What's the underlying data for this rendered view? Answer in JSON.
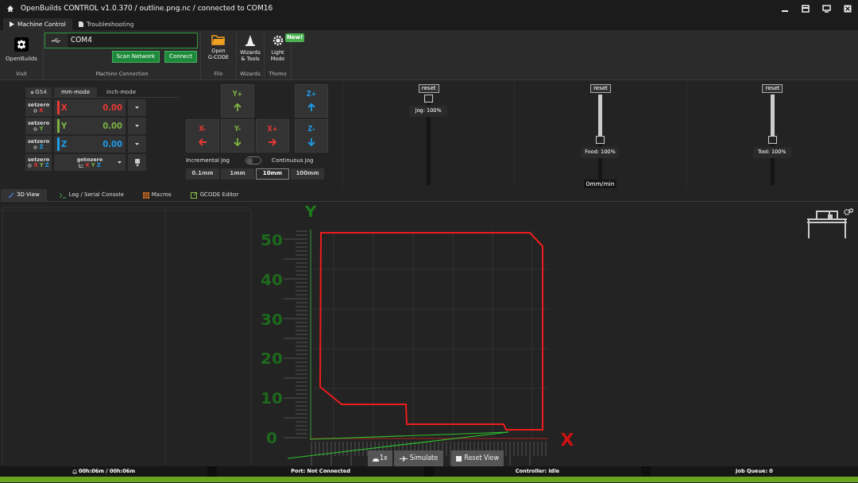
{
  "window": {
    "title": "OpenBuilds CONTROL v1.0.370 / outline.png.nc / connected to COM16"
  },
  "tabs": [
    {
      "label": "Machine Control",
      "selected": true
    },
    {
      "label": "Troubleshooting",
      "selected": false
    }
  ],
  "ribbon": {
    "visit": {
      "button": "OpenBuilds",
      "group": "Visit"
    },
    "connection": {
      "port": "COM4",
      "scan": "Scan Network",
      "connect": "Connect",
      "group": "Machine Connection"
    },
    "file": {
      "button": "Open G-CODE",
      "group": "File"
    },
    "wizards": {
      "button": "Wizards & Tools",
      "group": "Wizards"
    },
    "theme": {
      "button": "Light Mode",
      "badge": "New!",
      "group": "Theme"
    }
  },
  "dro": {
    "wcs": "G54",
    "units": [
      {
        "label": "mm-mode",
        "selected": true
      },
      {
        "label": "inch-mode",
        "selected": false
      }
    ],
    "rows": [
      {
        "setzero": "setzero",
        "setzero_axis": "X",
        "axis": "X",
        "value": "0.00",
        "color": "#e53935"
      },
      {
        "setzero": "setzero",
        "setzero_axis": "Y",
        "axis": "Y",
        "value": "0.00",
        "color": "#7cb342"
      },
      {
        "setzero": "setzero",
        "setzero_axis": "Z",
        "axis": "Z",
        "value": "0.00",
        "color": "#1e9be6"
      }
    ],
    "all": {
      "setzero": "setzero",
      "axes": [
        {
          "label": "X",
          "color": "#e53935"
        },
        {
          "label": "Y",
          "color": "#7cb342"
        },
        {
          "label": "Z",
          "color": "#1e9be6"
        }
      ],
      "gotozero": "gotozero",
      "goto_axes": [
        {
          "label": "X",
          "color": "#e53935"
        },
        {
          "label": "Y",
          "color": "#7cb342"
        },
        {
          "label": "Z",
          "color": "#1e9be6"
        }
      ]
    }
  },
  "jog": {
    "buttons": [
      {
        "label": "Y+",
        "kind": "y_up"
      },
      {
        "label": "Z+",
        "kind": "z_up"
      },
      {
        "label": "X-",
        "kind": "x_left"
      },
      {
        "label": "Y-",
        "kind": "y_down"
      },
      {
        "label": "X+",
        "kind": "x_right"
      },
      {
        "label": "Z-",
        "kind": "z_down"
      }
    ],
    "incremental": "Incremental Jog",
    "continuous": "Continuous Jog",
    "continuous_on": false,
    "steps": [
      {
        "label": "0.1mm",
        "selected": false
      },
      {
        "label": "1mm",
        "selected": false
      },
      {
        "label": "10mm",
        "selected": true
      },
      {
        "label": "100mm",
        "selected": false
      }
    ]
  },
  "overrides": [
    {
      "reset": "reset",
      "label": "Jog: 100%",
      "level": 1.0
    },
    {
      "reset": "reset",
      "label": "Feed: 100%",
      "level": 0.5,
      "reading": "0mm/min"
    },
    {
      "reset": "reset",
      "label": "Tool: 100%",
      "level": 0.5
    }
  ],
  "view_tabs": [
    {
      "label": "3D View",
      "selected": true,
      "kind": "view"
    },
    {
      "label": "Log / Serial Console",
      "selected": false,
      "kind": "console"
    },
    {
      "label": "Macros",
      "selected": false,
      "kind": "macros"
    },
    {
      "label": "GCODE Editor",
      "selected": false,
      "kind": "editor"
    }
  ],
  "viewer": {
    "y_axis": "Y",
    "x_axis": "X",
    "y_labels": [
      "50",
      "40",
      "30",
      "20",
      "10",
      "0"
    ],
    "speed": "1x",
    "simulate": "Simulate",
    "reset_view": "Reset View"
  },
  "status_bar": {
    "time": "00h:06m / 00h:06m",
    "port": "Port: Not Connected",
    "controller": "Controller: Idle",
    "queue": "Job Queue: 0"
  }
}
